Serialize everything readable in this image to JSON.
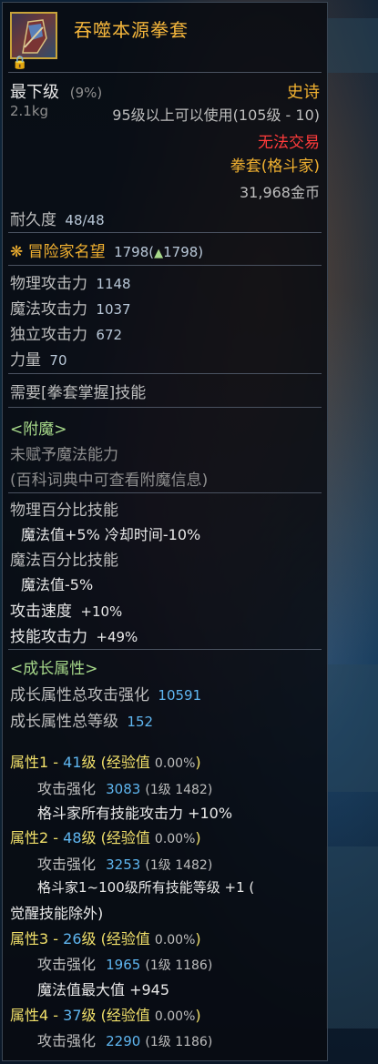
{
  "item": {
    "name": "吞噬本源拳套",
    "grade": "最下级",
    "grade_pct": "(9%)",
    "rarity": "史诗",
    "weight": "2.1kg",
    "level_req": "95级以上可以使用(105级 - 10)",
    "trade": "无法交易",
    "type": "拳套(格斗家)",
    "price": "31,968金币",
    "durability_label": "耐久度",
    "durability": "48/48",
    "fame_label": "冒险家名望",
    "fame": "1798",
    "fame_change": "1798"
  },
  "stats": [
    {
      "label": "物理攻击力",
      "value": "1148"
    },
    {
      "label": "魔法攻击力",
      "value": "1037"
    },
    {
      "label": "独立攻击力",
      "value": "672"
    },
    {
      "label": "力量",
      "value": "70"
    }
  ],
  "requirement": "需要[拳套掌握]技能",
  "enchant": {
    "title": "<附魔>",
    "line1": "未赋予魔法能力",
    "line2": "(百科词典中可查看附魔信息)"
  },
  "options": {
    "phys_skill": "物理百分比技能",
    "phys_detail": "魔法值+5% 冷却时间-10%",
    "mag_skill": "魔法百分比技能",
    "mag_detail": "魔法值-5%",
    "atk_speed_label": "攻击速度",
    "atk_speed": "+10%",
    "skill_atk_label": "技能攻击力",
    "skill_atk": "+49%"
  },
  "growth": {
    "title": "<成长属性>",
    "total_label": "成长属性总攻击强化",
    "total": "10591",
    "level_label": "成长属性总等级",
    "level": "152",
    "attrs": [
      {
        "head": "属性1 - ",
        "lvl": "41",
        "lvl_suffix": "级 (经验值 ",
        "exp": "0.00%",
        "close": ")",
        "strengthen_label": "攻击强化",
        "strengthen": "3083",
        "base": "(1级 1482)",
        "effect": "格斗家所有技能攻击力 +10%",
        "effect2": ""
      },
      {
        "head": "属性2 - ",
        "lvl": "48",
        "lvl_suffix": "级 (经验值 ",
        "exp": "0.00%",
        "close": ")",
        "strengthen_label": "攻击强化",
        "strengthen": "3253",
        "base": "(1级 1482)",
        "effect": "格斗家1~100级所有技能等级 +1 (",
        "effect2": "觉醒技能除外)"
      },
      {
        "head": "属性3 - ",
        "lvl": "26",
        "lvl_suffix": "级 (经验值 ",
        "exp": "0.00%",
        "close": ")",
        "strengthen_label": "攻击强化",
        "strengthen": "1965",
        "base": "(1级 1186)",
        "effect": "魔法值最大值 +945",
        "effect2": ""
      },
      {
        "head": "属性4 - ",
        "lvl": "37",
        "lvl_suffix": "级 (经验值 ",
        "exp": "0.00%",
        "close": ")",
        "strengthen_label": "攻击强化",
        "strengthen": "2290",
        "base": "(1级 1186)",
        "effect": "",
        "effect2": ""
      }
    ]
  },
  "icons": {
    "item": "fist-weapon-icon",
    "lock": "lock-icon",
    "fame": "fame-crest-icon",
    "up": "up-triangle-icon"
  },
  "colors": {
    "name": "#f6b73c",
    "rarity": "#f0b030",
    "trade": "#ff3b3b",
    "value_blue": "#5fb6f0",
    "enchant": "#a7d98a"
  }
}
